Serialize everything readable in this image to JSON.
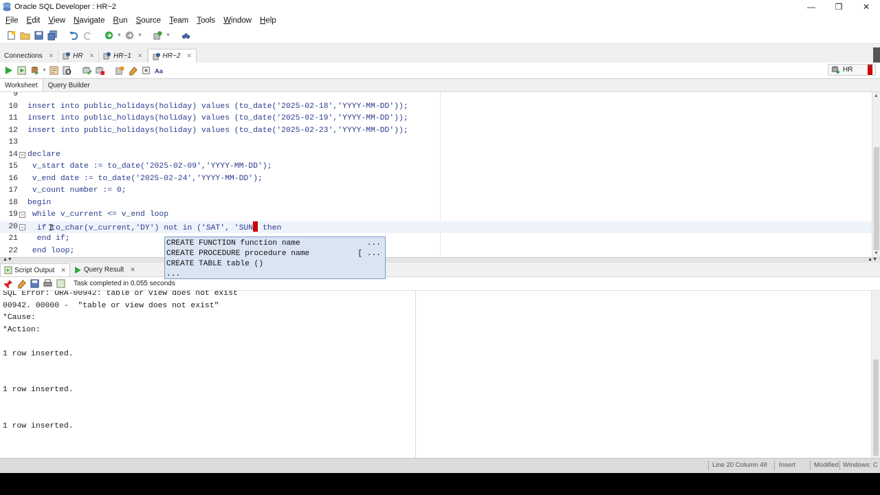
{
  "window": {
    "title": "Oracle SQL Developer : HR~2",
    "minimize": "—",
    "restore": "❐",
    "close": "✕"
  },
  "menu": [
    "File",
    "Edit",
    "View",
    "Navigate",
    "Run",
    "Source",
    "Team",
    "Tools",
    "Window",
    "Help"
  ],
  "editor_tabs": [
    {
      "label": "Connections",
      "active": false
    },
    {
      "label": "HR",
      "active": false
    },
    {
      "label": "HR~1",
      "active": false
    },
    {
      "label": "HR~2",
      "active": true
    }
  ],
  "connection": {
    "selected": "HR"
  },
  "sub_tabs": [
    "Worksheet",
    "Query Builder"
  ],
  "editor": {
    "current_line": 20,
    "lines": [
      {
        "n": "9",
        "code": ""
      },
      {
        "n": "10",
        "code": "insert into public_holidays(holiday) values (to_date('2025-02-18','YYYY-MM-DD'));"
      },
      {
        "n": "11",
        "code": "insert into public_holidays(holiday) values (to_date('2025-02-19','YYYY-MM-DD'));"
      },
      {
        "n": "12",
        "code": "insert into public_holidays(holiday) values (to_date('2025-02-23','YYYY-MM-DD'));"
      },
      {
        "n": "13",
        "code": ""
      },
      {
        "n": "14",
        "code": "declare"
      },
      {
        "n": "15",
        "code": " v_start date := to_date('2025-02-09','YYYY-MM-DD');"
      },
      {
        "n": "16",
        "code": " v_end date := to_date('2025-02-24','YYYY-MM-DD');"
      },
      {
        "n": "17",
        "code": " v_count number := 0;"
      },
      {
        "n": "18",
        "code": "begin"
      },
      {
        "n": "19",
        "code": " while v_current <= v_end loop"
      },
      {
        "n": "20",
        "code": "  if to_char(v_current,'DY') not in ('SAT', 'SUN"
      },
      {
        "n": "21",
        "code": "  end if;"
      },
      {
        "n": "22",
        "code": " end loop;"
      }
    ],
    "line20_after_caret": " then"
  },
  "autocomplete": {
    "items": [
      {
        "text": "CREATE FUNCTION function name",
        "suffix": "..."
      },
      {
        "text": "CREATE PROCEDURE procedure name",
        "suffix": "[ ..."
      },
      {
        "text": "CREATE TABLE table ()",
        "suffix": ""
      },
      {
        "text": "...",
        "suffix": ""
      }
    ]
  },
  "output_tabs": [
    {
      "label": "Script Output",
      "active": true
    },
    {
      "label": "Query Result",
      "active": false
    }
  ],
  "output_toolbar": {
    "status": "Task completed in 0.055 seconds"
  },
  "output": {
    "lines": [
      {
        "row": 0,
        "text": "SQL Error: ORA-00942: table or view does not exist"
      },
      {
        "row": 1,
        "text": "00942. 00000 -  \"table or view does not exist\""
      },
      {
        "row": 2,
        "text": "*Cause:"
      },
      {
        "row": 3,
        "text": "*Action:"
      },
      {
        "row": 5,
        "text": "1 row inserted."
      },
      {
        "row": 8,
        "text": "1 row inserted."
      },
      {
        "row": 11,
        "text": "1 row inserted."
      }
    ]
  },
  "statusbar": {
    "position": "Line 20 Column 48",
    "mode": "Insert",
    "modified": "Modified",
    "platform": "Windows: C"
  }
}
